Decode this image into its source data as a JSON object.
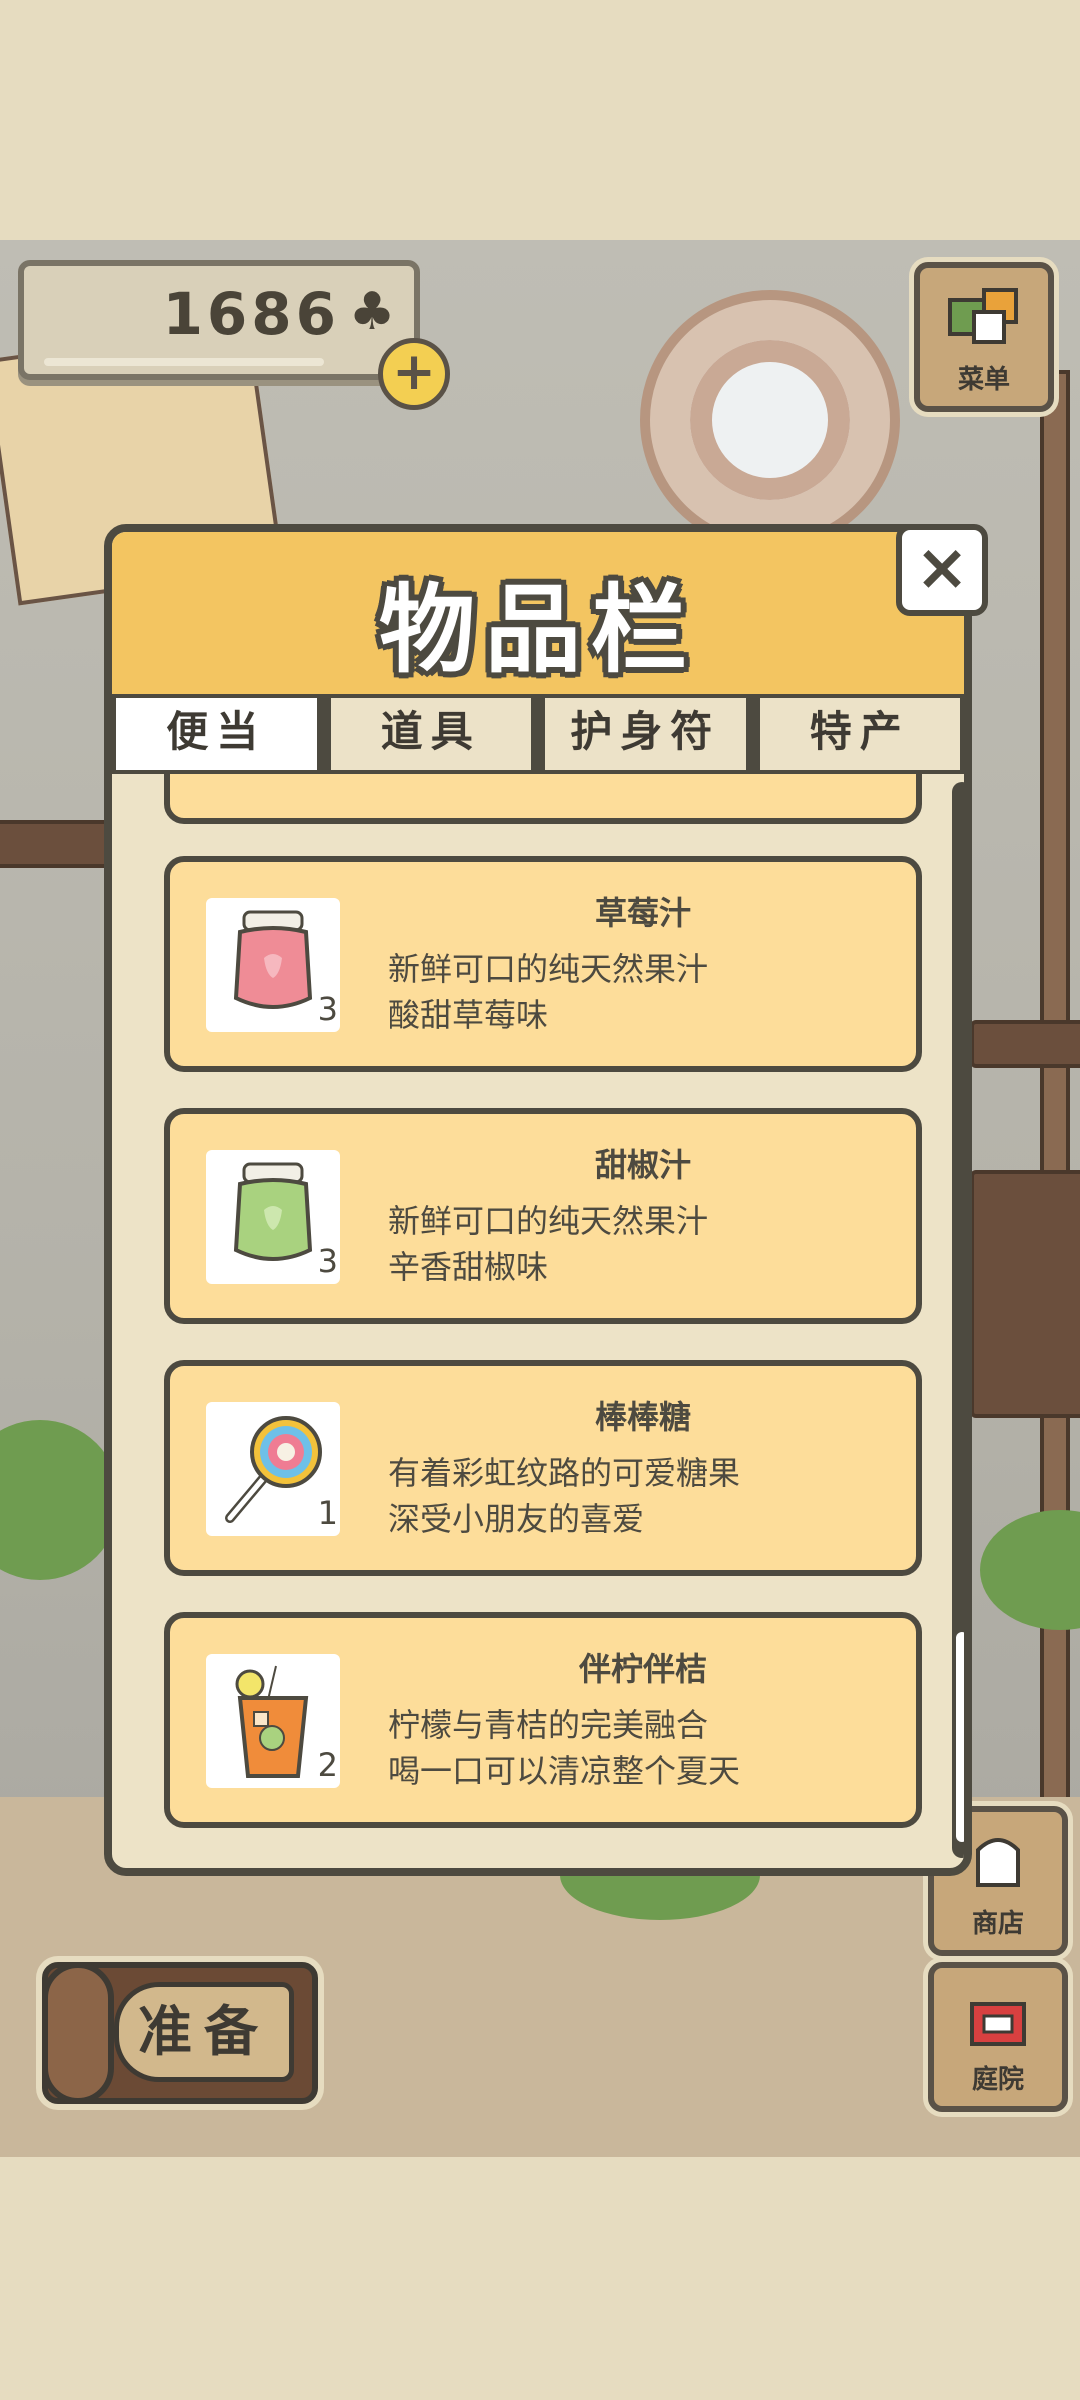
{
  "hud": {
    "clover_count": "1686",
    "clover_icon": "clover-icon",
    "plus_label": "+"
  },
  "menu_button": {
    "label": "菜单"
  },
  "shop_button": {
    "label": "商店"
  },
  "garden_button": {
    "label": "庭院"
  },
  "prepare_button": {
    "label": "准备"
  },
  "modal": {
    "title": "物品栏",
    "close_label": "×",
    "tabs": [
      {
        "label": "便当",
        "active": true
      },
      {
        "label": "道具",
        "active": false
      },
      {
        "label": "护身符",
        "active": false
      },
      {
        "label": "特产",
        "active": false
      }
    ],
    "items": [
      {
        "name": "草莓汁",
        "desc_line1": "新鲜可口的纯天然果汁",
        "desc_line2": "酸甜草莓味",
        "qty": "3",
        "icon": "strawberry-juice-jar-icon"
      },
      {
        "name": "甜椒汁",
        "desc_line1": "新鲜可口的纯天然果汁",
        "desc_line2": "辛香甜椒味",
        "qty": "3",
        "icon": "pepper-juice-jar-icon"
      },
      {
        "name": "棒棒糖",
        "desc_line1": "有着彩虹纹路的可爱糖果",
        "desc_line2": "深受小朋友的喜爱",
        "qty": "1",
        "icon": "lollipop-icon"
      },
      {
        "name": "伴柠伴桔",
        "desc_line1": "柠檬与青桔的完美融合",
        "desc_line2": "喝一口可以清凉整个夏天",
        "qty": "2",
        "icon": "citrus-drink-icon"
      }
    ]
  }
}
